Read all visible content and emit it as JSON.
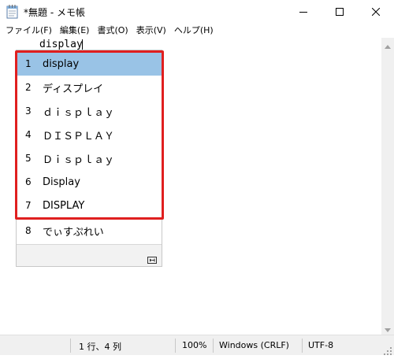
{
  "window": {
    "title": "*無題 - メモ帳",
    "icon": "notepad-icon",
    "controls": [
      "minimize-icon",
      "maximize-icon",
      "close-icon"
    ]
  },
  "menu": {
    "items": [
      "ファイル(F)",
      "編集(E)",
      "書式(O)",
      "表示(V)",
      "ヘルプ(H)"
    ]
  },
  "editor": {
    "text": "display"
  },
  "ime": {
    "candidates": [
      {
        "num": "1",
        "text": "display"
      },
      {
        "num": "2",
        "text": "ディスプレイ"
      },
      {
        "num": "3",
        "text": "ｄｉｓｐｌａｙ"
      },
      {
        "num": "4",
        "text": "ＤＩＳＰＬＡＹ"
      },
      {
        "num": "5",
        "text": "Ｄｉｓｐｌａｙ"
      },
      {
        "num": "6",
        "text": "Display"
      },
      {
        "num": "7",
        "text": "DISPLAY"
      },
      {
        "num": "8",
        "text": "でぃすぷれい"
      }
    ],
    "selected_index": 0,
    "expand_icon": "expand-candidates-icon"
  },
  "status": {
    "position": "1 行、4 列",
    "zoom": "100%",
    "line_ending": "Windows (CRLF)",
    "encoding": "UTF-8"
  },
  "colors": {
    "selection": "#99c3e6",
    "highlight_box": "#e01f1f",
    "statusbar_bg": "#f0f0f0"
  }
}
